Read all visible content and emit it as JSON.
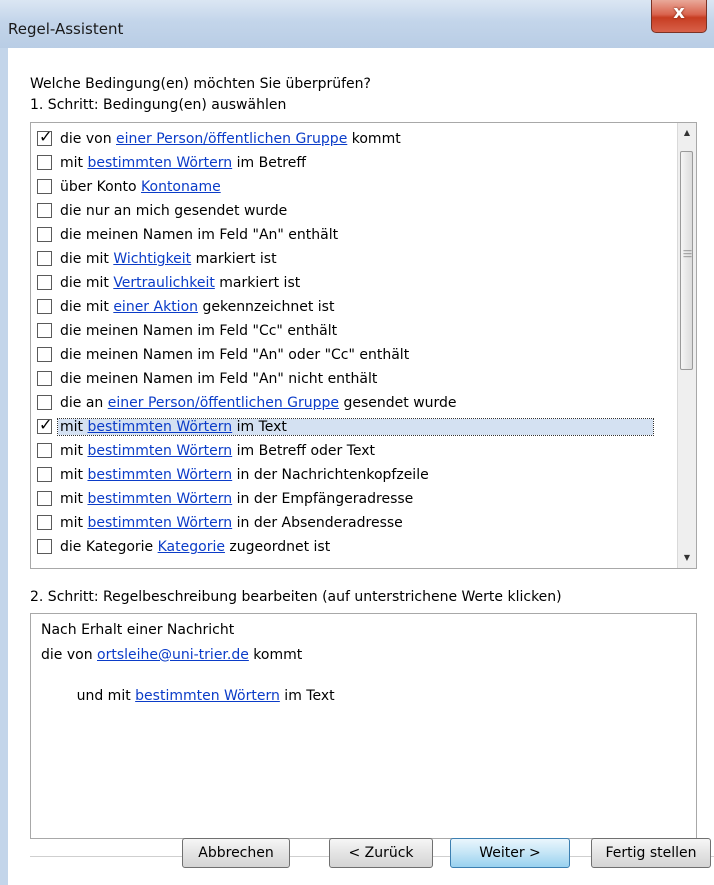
{
  "window": {
    "title": "Regel-Assistent",
    "close_label": "x"
  },
  "question": "Welche Bedingung(en) möchten Sie überprüfen?",
  "step1_label": "1. Schritt: Bedingung(en) auswählen",
  "conditions": [
    {
      "checked": true,
      "pre": "die von ",
      "link": "einer Person/öffentlichen Gruppe",
      "post": " kommt"
    },
    {
      "checked": false,
      "pre": "mit ",
      "link": "bestimmten Wörtern",
      "post": " im Betreff"
    },
    {
      "checked": false,
      "pre": "über Konto ",
      "link": "Kontoname",
      "post": ""
    },
    {
      "checked": false,
      "pre": "die nur an mich gesendet wurde",
      "link": "",
      "post": ""
    },
    {
      "checked": false,
      "pre": "die meinen Namen im Feld \"An\" enthält",
      "link": "",
      "post": ""
    },
    {
      "checked": false,
      "pre": "die mit ",
      "link": "Wichtigkeit",
      "post": " markiert ist"
    },
    {
      "checked": false,
      "pre": "die mit ",
      "link": "Vertraulichkeit",
      "post": " markiert ist"
    },
    {
      "checked": false,
      "pre": "die mit ",
      "link": "einer Aktion",
      "post": " gekennzeichnet ist"
    },
    {
      "checked": false,
      "pre": "die meinen Namen im Feld \"Cc\" enthält",
      "link": "",
      "post": ""
    },
    {
      "checked": false,
      "pre": "die meinen Namen im Feld \"An\" oder \"Cc\" enthält",
      "link": "",
      "post": ""
    },
    {
      "checked": false,
      "pre": "die meinen Namen im Feld \"An\" nicht enthält",
      "link": "",
      "post": ""
    },
    {
      "checked": false,
      "pre": "die an ",
      "link": "einer Person/öffentlichen Gruppe",
      "post": " gesendet wurde"
    },
    {
      "checked": true,
      "selected": true,
      "pre": "mit ",
      "link": "bestimmten Wörtern",
      "post": " im Text"
    },
    {
      "checked": false,
      "pre": "mit ",
      "link": "bestimmten Wörtern",
      "post": " im Betreff oder Text"
    },
    {
      "checked": false,
      "pre": "mit ",
      "link": "bestimmten Wörtern",
      "post": " in der Nachrichtenkopfzeile"
    },
    {
      "checked": false,
      "pre": "mit ",
      "link": "bestimmten Wörtern",
      "post": " in der Empfängeradresse"
    },
    {
      "checked": false,
      "pre": "mit ",
      "link": "bestimmten Wörtern",
      "post": " in der Absenderadresse"
    },
    {
      "checked": false,
      "pre": "die Kategorie ",
      "link": "Kategorie",
      "post": " zugeordnet ist"
    }
  ],
  "step2_label": "2. Schritt: Regelbeschreibung bearbeiten (auf unterstrichene Werte klicken)",
  "description": {
    "line1": "Nach Erhalt einer Nachricht",
    "line2_pre": "die von ",
    "line2_link": "ortsleihe@uni-trier.de",
    "line2_post": " kommt",
    "line3_pre": "  und mit ",
    "line3_link": "bestimmten Wörtern",
    "line3_post": " im Text"
  },
  "buttons": {
    "cancel": "Abbrechen",
    "back": "< Zurück",
    "next": "Weiter >",
    "finish": "Fertig stellen"
  }
}
